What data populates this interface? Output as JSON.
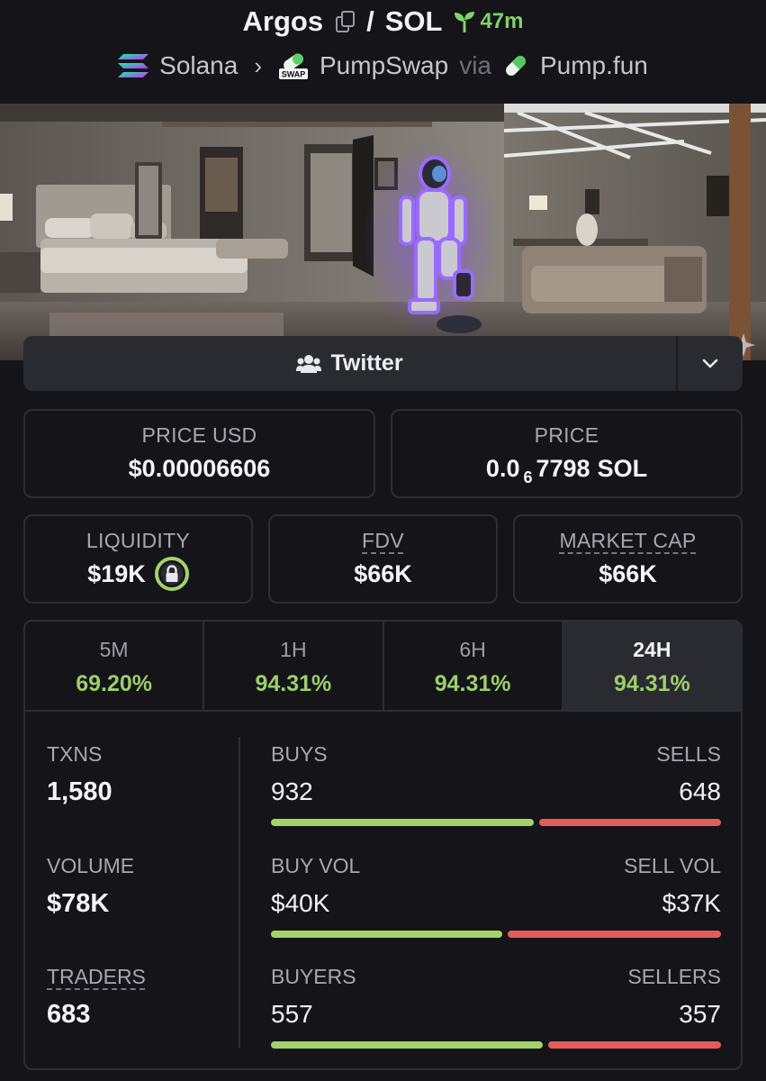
{
  "header": {
    "token_name": "Argos",
    "separator": "/",
    "quote_symbol": "SOL",
    "age": "47m",
    "chain": "Solana",
    "dex": "PumpSwap",
    "via_label": "via",
    "launchpad": "Pump.fun",
    "swap_badge": "SWAP",
    "icons": [
      "copy-icon",
      "sprout-icon",
      "solana-icon",
      "chevron-right-icon",
      "pumpswap-icon",
      "pill-icon"
    ]
  },
  "social": {
    "label": "Twitter",
    "icons": [
      "people-icon",
      "chevron-down-icon"
    ]
  },
  "prices": {
    "price_usd_label": "PRICE USD",
    "price_usd": "$0.00006606",
    "price_label": "PRICE",
    "price_prefix": "0.0",
    "price_zero_count": "6",
    "price_digits": "7798",
    "price_unit": "SOL"
  },
  "metrics": {
    "liquidity_label": "LIQUIDITY",
    "liquidity": "$19K",
    "fdv_label": "FDV",
    "fdv": "$66K",
    "mcap_label": "MARKET CAP",
    "mcap": "$66K"
  },
  "tabs": [
    {
      "label": "5M",
      "value": "69.20%",
      "active": false
    },
    {
      "label": "1H",
      "value": "94.31%",
      "active": false
    },
    {
      "label": "6H",
      "value": "94.31%",
      "active": false
    },
    {
      "label": "24H",
      "value": "94.31%",
      "active": true
    }
  ],
  "stats": {
    "txns_label": "TXNS",
    "txns": "1,580",
    "volume_label": "VOLUME",
    "volume": "$78K",
    "traders_label": "TRADERS",
    "traders": "683"
  },
  "ratios": [
    {
      "left_label": "BUYS",
      "right_label": "SELLS",
      "left_value": "932",
      "right_value": "648",
      "left_fraction": 0.59
    },
    {
      "left_label": "BUY VOL",
      "right_label": "SELL VOL",
      "left_value": "$40K",
      "right_value": "$37K",
      "left_fraction": 0.52
    },
    {
      "left_label": "BUYERS",
      "right_label": "SELLERS",
      "left_value": "557",
      "right_value": "357",
      "left_fraction": 0.61
    }
  ],
  "colors": {
    "background": "#141419",
    "positive": "#9bcf6a",
    "buy_bar": "#a4d36a",
    "sell_bar": "#e35d5b",
    "age_green": "#7fd36a",
    "robot_glow": "#8a4dff"
  }
}
